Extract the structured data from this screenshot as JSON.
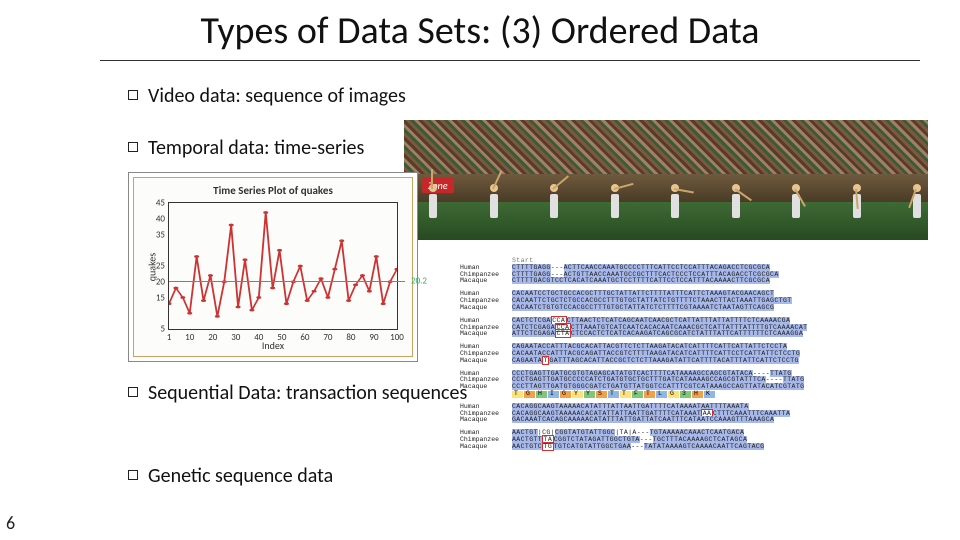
{
  "title": "Types of Data Sets: (3) Ordered Data",
  "page_number": "6",
  "bullets": {
    "video": "Video data: sequence of images",
    "temporal": "Temporal data: time-series",
    "sequential": "Sequential Data: transaction sequences",
    "genetic": "Genetic sequence data"
  },
  "video_panel": {
    "sign_text": "Zone",
    "frame_count": 9
  },
  "chart_data": {
    "type": "line",
    "title": "Time Series Plot of quakes",
    "xlabel": "Index",
    "ylabel": "quakes",
    "x_ticks": [
      1,
      10,
      20,
      30,
      40,
      50,
      60,
      70,
      80,
      90,
      100
    ],
    "y_ticks": [
      5,
      15,
      20,
      25,
      35,
      40,
      45
    ],
    "xlim": [
      1,
      100
    ],
    "ylim": [
      5,
      45
    ],
    "mean_value": 20.2,
    "mean_label": "20.2",
    "x": [
      1,
      4,
      7,
      10,
      13,
      16,
      19,
      22,
      25,
      28,
      31,
      34,
      37,
      40,
      43,
      46,
      49,
      52,
      55,
      58,
      61,
      64,
      67,
      70,
      73,
      76,
      79,
      82,
      85,
      88,
      91,
      94,
      97,
      100
    ],
    "values": [
      13,
      18,
      15,
      10,
      28,
      14,
      22,
      9,
      20,
      38,
      12,
      27,
      11,
      15,
      42,
      18,
      30,
      13,
      20,
      25,
      14,
      17,
      21,
      15,
      24,
      33,
      14,
      19,
      22,
      17,
      28,
      13,
      20,
      24
    ]
  },
  "alignment": {
    "start_label": "Start",
    "species": [
      "Human",
      "Chimpanzee",
      "Macaque"
    ],
    "blocks": [
      {
        "rows": [
          "CTTTTGAGG---ACTTCAACCAAATGCCCCTTTCATTCCTCCATTTACAGACCTCGCGCA",
          "CTTTTGAGG---ACTGTTAACCAAATGCCGCTTTCACTCCCTCCATTTACAGACCTCGCGCA",
          "CTTTTGACGTCCTCACATCAAATGCTCCTTTTCATTCCTCCATTTACAAAACTTCGCGCA"
        ]
      },
      {
        "rows": [
          "CACAATCCTGCTGCCACGCTTTGCTATTATTCTTTTATTTCATTCTAAAGTACGAACAGCT",
          "CACAATTCTGCTCTGCCACGCCTTTGTGCTATTATCTGTTTTCTAAACTTACTAAATTGAGCTGT",
          "CACAATCTGTGTCCACGCCTTTGTGCTATTATCTCTTTTCGTAAAATCTAATAGTTCAGCG"
        ]
      },
      {
        "hl_index": 18,
        "rows": [
          "CACTCTCGA|CCA|CTTAACTCTCATCAGCAATCAACGCTCATTATTTATTATTTTCTCAAAACGA",
          "CATCTCGAGA|CCA|CTTAAATGTCATCAATCACACAATCAAACGCTCATTATTTATTTTGTCAAAACAT",
          "ATTCTCGAGA|CTA|CTCCACTCTCATCACAAGATCAGCGCATCTATTTATTCATTTTTTCTCAAAGGA"
        ]
      },
      {
        "rows": [
          "CAGAATACCATTTACGCACATTACGTTCTCTTAAGATACATCATTTTCATTCATTATTCTCCTA",
          "CACAATACCATTTACGCAGATTACCGTCTTTTAAGATACATCATTTTCATTCCTCATTATTCTCCTG",
          "CAGAATA|T|GATTTAGCACATTACCGCTCTCTTAAAGATATTCATTTTACATTTATTCATTCTCCTG"
        ]
      },
      {
        "rows": [
          "CCCTGAGTTGATGCGTGTAGAGCATATGTCACTTTTCATAAAAGCCAGCGTATACA----TTATG",
          "CCCTGAGTTGATGCCCCCATCTGATGTGCTGCTTTGATCATAAAAGCCAGCGTATTTCA----TTATG",
          "CCCTTAGTTGATGTGGGCGATCTGATGTTATGGTCCATTTCGTCATAAAGCCAGTTATACATCGTATG"
        ],
        "aa_row": "TGHIGYYSTTFTLG3HK"
      },
      {
        "hl_index": 20,
        "rows": [
          "CACAGGCAAGTAAAAACATATTTATTAATTGATTTTCATAAAATAATTTTAAATA",
          "CACAGGCAAGTAAAAACACATATTATTAATTGATTTTCATAAAT|AA|CTTTCAAATTTCAAATTA",
          "GACAAATCACAGCAAAAACATATTTATTGATTATCAATTTCATAATCCAAAGTTTAAAGCA"
        ]
      },
      {
        "hl_index": 21,
        "rows": [
          "AACTGT|CG|CGGTATGTATTGGC|TA|A---TGTAAAAACAAACTCAATGACA",
          "AACTGTT|TA|CGGTCTATAGATTGGCTGTA---TGCTTTACAAAAGCTCATAGCA",
          "AACTGTC|TG|TGTCATGTATTGGCTGAA---TATATAAAAGTCAAAACAATTCAGTACG"
        ]
      }
    ]
  }
}
